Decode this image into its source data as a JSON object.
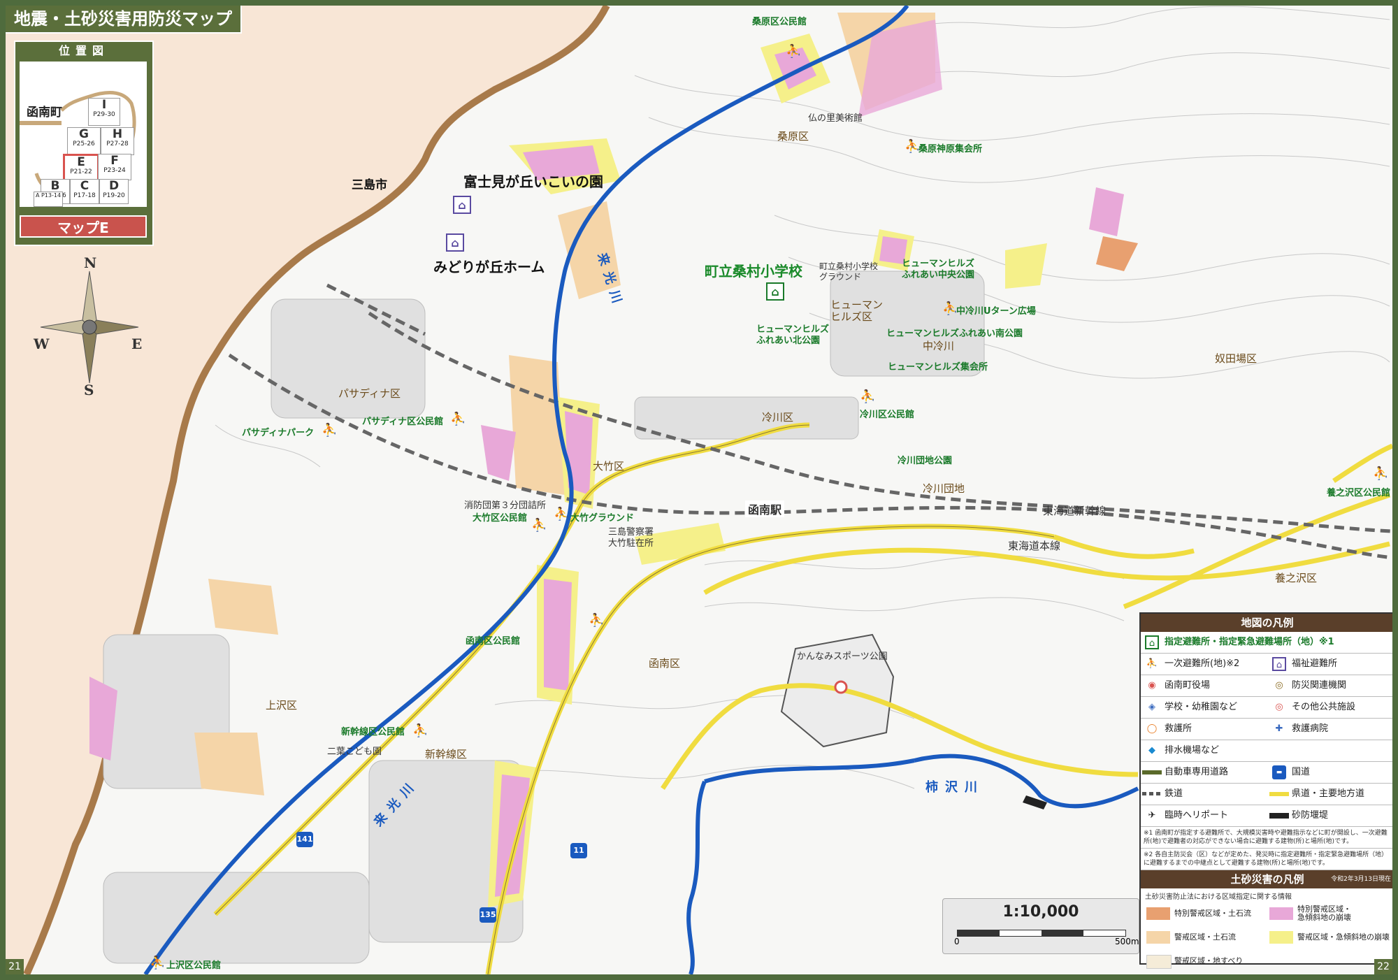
{
  "title": "地震・土砂災害用防災マップ",
  "location_map": {
    "title": "位置図",
    "town": "函南町",
    "sheets": [
      {
        "letter": "I",
        "pages": "P29-30"
      },
      {
        "letter": "G",
        "pages": "P25-26"
      },
      {
        "letter": "H",
        "pages": "P27-28"
      },
      {
        "letter": "E",
        "pages": "P21-22",
        "active": true
      },
      {
        "letter": "F",
        "pages": "P23-24"
      },
      {
        "letter": "B",
        "pages": "P15-16"
      },
      {
        "letter": "C",
        "pages": "P17-18"
      },
      {
        "letter": "D",
        "pages": "P19-20"
      },
      {
        "letter": "A",
        "pages": "P13-14"
      }
    ],
    "current_map": "マップE"
  },
  "compass": {
    "n": "N",
    "s": "S",
    "e": "E",
    "w": "W"
  },
  "labels": {
    "mishima": "三島市",
    "fujimigaoka": "富士見が丘いこいの園",
    "midorigaoka": "みどりが丘ホーム",
    "kuwahara_kominkan": "桑原区公民館",
    "hotoke_museum": "仏の里美術館",
    "kuwahara_ku": "桑原区",
    "kuwahara_shinbara": "桑原神原集会所",
    "kuwamura_school": "町立桑村小学校",
    "kuwamura_ground": "町立桑村小学校\nグラウンド",
    "hh_chuo": "ヒューマンヒルズ\nふれあい中央公園",
    "hh_ku": "ヒューマン\nヒルズ区",
    "naka_hiekawa_park": "中冷川Uターン広場",
    "hh_kita": "ヒューマンヒルズ\nふれあい北公園",
    "hh_minami": "ヒューマンヒルズふれあい南公園",
    "naka_hiekawa": "中冷川",
    "hh_shukai": "ヒューマンヒルズ集会所",
    "kamadaba": "奴田場区",
    "pasadena_ku": "パサディナ区",
    "pasadena_park": "パサディナパーク",
    "pasadena_kominkan": "パサディナ区公民館",
    "hiekawa_ku": "冷川区",
    "hiekawa_kominkan": "冷川区公民館",
    "hiekawa_danchi_park": "冷川団地公園",
    "hiekawa_danchi": "冷川団地",
    "otake_ku": "大竹区",
    "fire_station": "消防団第３分団詰所",
    "otake_kominkan": "大竹区公民館",
    "otake_ground": "大竹グラウンド",
    "kannami_station": "函南駅",
    "police": "三島警察署\n大竹駐在所",
    "shinkansen": "東海道新幹線",
    "honsen": "東海道本線",
    "minosawa_kominkan": "養之沢区公民館",
    "minosawa_ku": "養之沢区",
    "kannami_kominkan": "函南区公民館",
    "kannami_ku": "函南区",
    "sports_park": "かんなみスポーツ公園",
    "kamisawa_ku": "上沢区",
    "shinkansen_ku_kominkan": "新幹線区公民館",
    "futaba": "二葉こども園",
    "shinkansen_ku": "新幹線区",
    "kisawa_river": "柿沢川",
    "kiko_river_1": "来光川",
    "kiko_river_2": "来光川",
    "kamisawa_kominkan": "上沢区公民館",
    "route_141": "141",
    "route_11": "11",
    "route_135": "135"
  },
  "scale": {
    "ratio": "1:10,000",
    "start": "0",
    "end": "500m"
  },
  "page_left": "21",
  "page_right": "22",
  "legend": {
    "title": "地図の凡例",
    "rows": [
      {
        "full": "指定避難所・指定緊急避難場所（地）※1"
      },
      {
        "left": "一次避難所(地)※2",
        "right": "福祉避難所"
      },
      {
        "left": "函南町役場",
        "right": "防災関連機関"
      },
      {
        "left": "学校・幼稚園など",
        "right": "その他公共施設"
      },
      {
        "left": "救護所",
        "right": "救護病院"
      },
      {
        "left": "排水機場など"
      },
      {
        "left": "自動車専用道路",
        "right": "国道"
      },
      {
        "left": "鉄道",
        "right": "県道・主要地方道"
      },
      {
        "left": "臨時ヘリポート",
        "right": "砂防堰堤"
      }
    ],
    "note1": "※1 函南町が指定する避難所で、大規模災害時や避難指示などに町が開設し、一次避難所(地)で避難者の対応ができない場合に避難する建物(所)と場所(地)です。",
    "note2": "※2 各自主防災会（区）などが定めた、発災時に指定避難所・指定緊急避難場所（地）に避難するまでの中継点として避難する建物(所)と場所(地)です。",
    "sediment_title": "土砂災害の凡例",
    "sediment_date": "令和2年3月13日現在",
    "sediment_sub": "土砂災害防止法における区域指定に関する情報",
    "zones": [
      {
        "label": "特別警戒区域・土石流",
        "color": "#e8a070"
      },
      {
        "label": "特別警戒区域・\n急傾斜地の崩壊",
        "color": "#e8a8d8"
      },
      {
        "label": "警戒区域・土石流",
        "color": "#f5d5a8"
      },
      {
        "label": "警戒区域・急傾斜地の崩壊",
        "color": "#f5f08a"
      },
      {
        "label": "警戒区域・地すべり",
        "color": "#f5ecd8"
      }
    ]
  },
  "colors": {
    "frame": "#4f6b3d",
    "river": "#1a5abf",
    "road": "#f0dc40",
    "special_steep": "#e8a8d8",
    "steep": "#f5f08a",
    "debris": "#f5d5a8",
    "shelter": "#1a7a2a"
  }
}
